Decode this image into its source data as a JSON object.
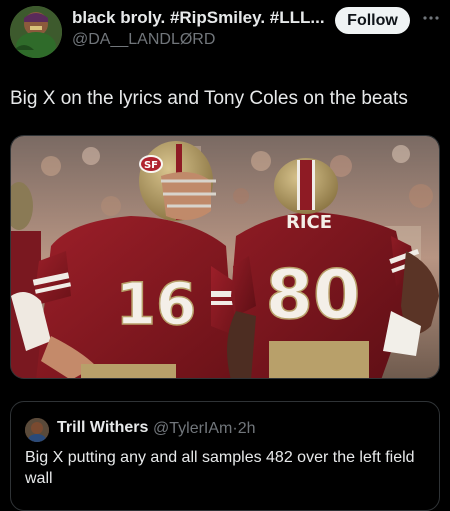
{
  "header": {
    "display_name": "black broly. #RipSmiley. #LLL...",
    "handle": "@DA__LANDLØRD",
    "follow_label": "Follow",
    "more_icon": "more-horizontal-icon"
  },
  "tweet": {
    "text": "Big X on the lyrics and Tony Coles on the beats"
  },
  "media": {
    "jersey_left_number": "16",
    "jersey_right_number": "80",
    "jersey_right_name": "RICE",
    "helmet_logo": "SF"
  },
  "quote": {
    "display_name": "Trill Withers",
    "handle": "@TylerIAm",
    "separator": "·",
    "time": "2h",
    "text": "Big X putting any and all samples 482 over the left field wall"
  },
  "colors": {
    "background": "#000000",
    "text_primary": "#e7e9ea",
    "text_secondary": "#71767b",
    "border": "#2f3336",
    "follow_bg": "#eff3f4",
    "jersey_red": "#8e1b24",
    "helmet_gold": "#b3995d"
  }
}
